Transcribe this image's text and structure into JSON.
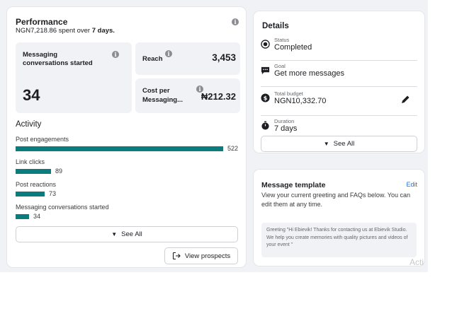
{
  "performance": {
    "title": "Performance",
    "spent_amount": "NGN7,218.86",
    "spent_text": " spent over ",
    "spent_period": "7 days.",
    "messaging_label": "Messaging conversations started",
    "messaging_value": "34",
    "reach_label": "Reach",
    "reach_value": "3,453",
    "cost_label_1": "Cost per",
    "cost_label_2": "Messaging...",
    "cost_value": "₦212.32"
  },
  "activity": {
    "title": "Activity",
    "items": [
      {
        "label": "Post engagements",
        "value": "522",
        "fraction": 1.0
      },
      {
        "label": "Link clicks",
        "value": "89",
        "fraction": 0.17
      },
      {
        "label": "Post reactions",
        "value": "73",
        "fraction": 0.14
      },
      {
        "label": "Messaging conversations started",
        "value": "34",
        "fraction": 0.065
      }
    ],
    "see_all": "See All",
    "view_prospects": "View prospects"
  },
  "details": {
    "title": "Details",
    "rows": [
      {
        "small": "Status",
        "value": "Completed",
        "icon": "radio-icon"
      },
      {
        "small": "Goal",
        "value": "Get more messages",
        "icon": "chat-icon"
      },
      {
        "small": "Total budget",
        "value": "NGN10,332.70",
        "icon": "dollar-icon"
      },
      {
        "small": "Duration",
        "value": "7 days",
        "icon": "stopwatch-icon"
      }
    ],
    "see_all": "See All"
  },
  "message_template": {
    "title": "Message template",
    "edit": "Edit",
    "description": "View your current greeting and FAQs below. You can edit them at any time.",
    "greeting": "Greeting \"Hi Ebievik! Thanks for contacting us at Ebievik Studio. We help you create memories with quality pictures and videos of your event \""
  },
  "watermark": "Acti",
  "colors": {
    "bar": "#0b7b7e",
    "link": "#216fdb",
    "panel_bg": "#f0f2f5"
  }
}
